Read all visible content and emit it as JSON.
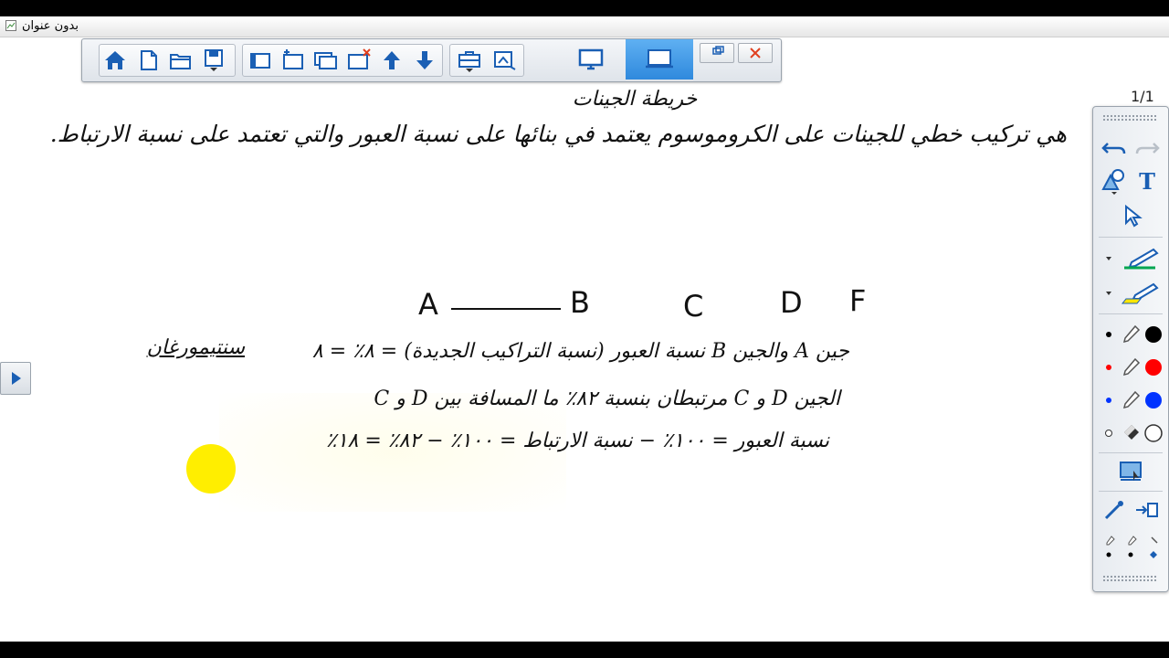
{
  "window": {
    "doc_title": "بدون عنوان"
  },
  "toolbar": {
    "buttons": [
      "home-icon",
      "new-page-icon",
      "open-folder-icon",
      "save-icon",
      "blank-page-icon",
      "add-page-icon",
      "duplicate-page-icon",
      "delete-page-icon",
      "move-up-icon",
      "move-down-icon",
      "toolbox-icon",
      "capture-icon"
    ],
    "views": [
      "desktop-view-icon",
      "whiteboard-view-icon"
    ],
    "window_controls": {
      "restore_label": "🗗",
      "close_label": "✕"
    }
  },
  "page_counter": "1/1",
  "canvas": {
    "title": "خريطة الجينات",
    "definition": "هي تركيب خطي للجينات على الكروموسوم يعتمد في بنائها على نسبة العبور والتي تعتمد على نسبة الارتباط.",
    "genes": [
      "A",
      "B",
      "C",
      "D",
      "F"
    ],
    "line1": "جين A والجين B نسبة العبور (نسبة التراكيب الجديدة) = ٨٪ = ٨",
    "side_note": "سنتيمورغان",
    "line2": "الجين D و C مرتبطان بنسبة ٨٢٪ ما المسافة بين D و C",
    "line3": "نسبة العبور = ١٠٠٪ − نسبة الارتباط = ١٠٠٪ − ٨٢٪ = ١٨٪"
  },
  "colors": {
    "accent": "#2f89dd",
    "pen_green": "#00a651",
    "pen_yellow": "#ffe600",
    "dot_black": "#000000",
    "dot_red": "#ff0000",
    "dot_blue": "#0033ff",
    "pointer_yellow": "#ffee00"
  }
}
